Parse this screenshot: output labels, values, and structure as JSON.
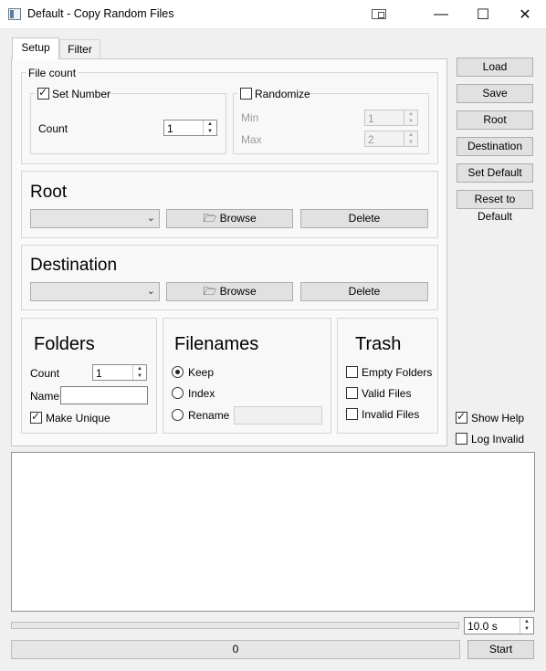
{
  "window": {
    "title": "Default - Copy Random Files",
    "minimize_glyph": "—",
    "maximize_glyph": "☐",
    "close_glyph": "✕",
    "icon_names": [
      "app-icon",
      "snap-layout-icon"
    ]
  },
  "tabs": [
    {
      "label": "Setup",
      "active": true
    },
    {
      "label": "Filter",
      "active": false
    }
  ],
  "file_count": {
    "title": "File count",
    "set_number": {
      "label": "Set Number",
      "checked": true,
      "count_label": "Count",
      "count_value": "1"
    },
    "randomize": {
      "label": "Randomize",
      "checked": false,
      "min_label": "Min",
      "min_value": "1",
      "max_label": "Max",
      "max_value": "2"
    }
  },
  "root": {
    "title": "Root",
    "browse_label": "Browse",
    "delete_label": "Delete",
    "selected": ""
  },
  "destination": {
    "title": "Destination",
    "browse_label": "Browse",
    "delete_label": "Delete",
    "selected": ""
  },
  "folders": {
    "title": "Folders",
    "count_label": "Count",
    "count_value": "1",
    "name_label": "Name",
    "name_value": "",
    "make_unique_label": "Make Unique",
    "make_unique_checked": true
  },
  "filenames": {
    "title": "Filenames",
    "options": [
      {
        "label": "Keep",
        "selected": true
      },
      {
        "label": "Index",
        "selected": false
      },
      {
        "label": "Rename",
        "selected": false
      }
    ],
    "rename_value": ""
  },
  "trash": {
    "title": "Trash",
    "options": [
      {
        "label": "Empty Folders",
        "checked": false
      },
      {
        "label": "Valid Files",
        "checked": false
      },
      {
        "label": "Invalid Files",
        "checked": false
      }
    ]
  },
  "side_buttons": {
    "load": "Load",
    "save": "Save",
    "root": "Root",
    "destination": "Destination",
    "set_default": "Set Default",
    "reset_default": "Reset to Default"
  },
  "show_help": {
    "label": "Show Help",
    "checked": true
  },
  "log_invalid": {
    "label": "Log Invalid",
    "checked": false
  },
  "log_text": "",
  "progress": {
    "fraction": 0.0
  },
  "timeout": {
    "value": "10.0 s"
  },
  "status": {
    "count": "0"
  },
  "start_label": "Start"
}
